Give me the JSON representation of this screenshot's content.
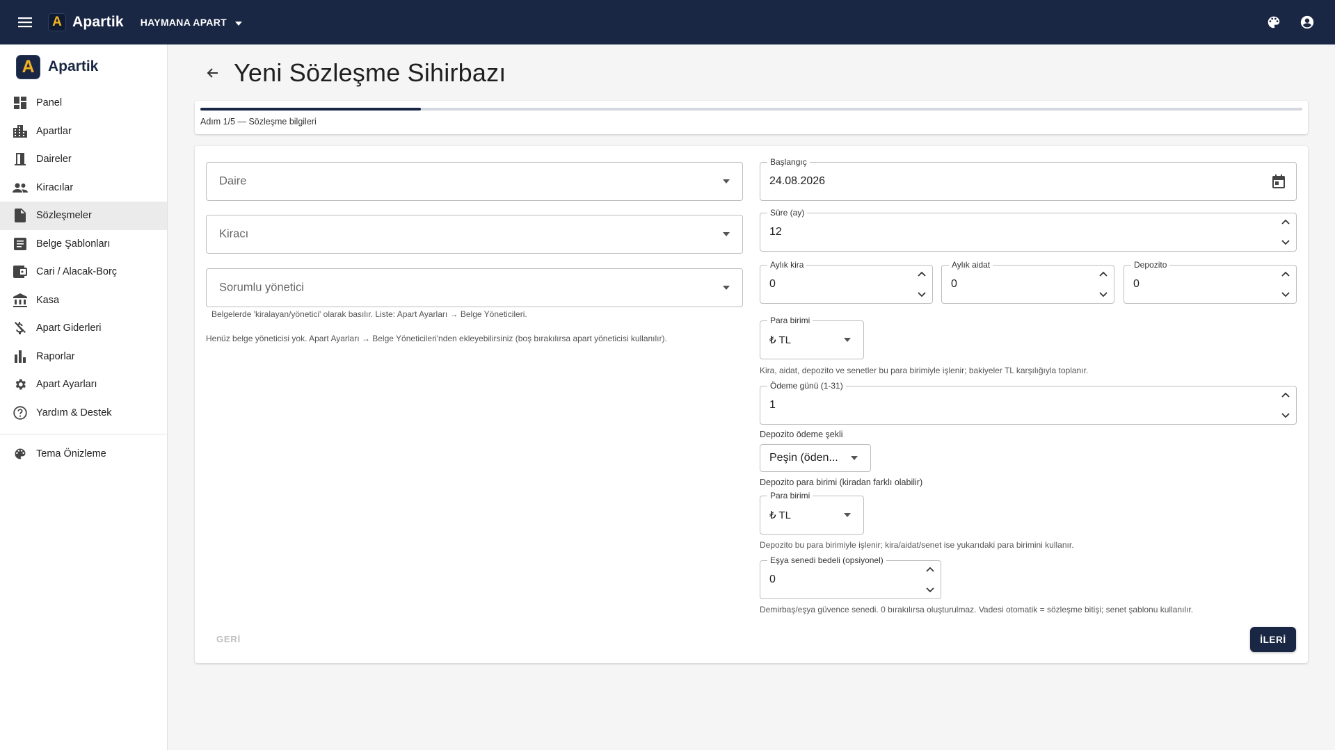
{
  "topbar": {
    "logo_letter": "A",
    "brand": "Apartik",
    "apart_name": "HAYMANA APART",
    "icons": [
      "menu-icon",
      "palette-icon",
      "account-icon"
    ]
  },
  "sidebar": {
    "logo_letter": "A",
    "brand": "Apartik",
    "items": [
      {
        "label": "Panel",
        "icon": "dashboard-icon"
      },
      {
        "label": "Apartlar",
        "icon": "apartment-icon"
      },
      {
        "label": "Daireler",
        "icon": "door-icon"
      },
      {
        "label": "Kiracılar",
        "icon": "people-icon"
      },
      {
        "label": "Sözleşmeler",
        "icon": "document-icon",
        "active": true
      },
      {
        "label": "Belge Şablonları",
        "icon": "template-icon"
      },
      {
        "label": "Cari / Alacak-Borç",
        "icon": "ledger-icon"
      },
      {
        "label": "Kasa",
        "icon": "bank-icon"
      },
      {
        "label": "Apart Giderleri",
        "icon": "money-off-icon"
      },
      {
        "label": "Raporlar",
        "icon": "bar-chart-icon"
      },
      {
        "label": "Apart Ayarları",
        "icon": "gear-icon"
      },
      {
        "label": "Yardım & Destek",
        "icon": "help-icon"
      }
    ],
    "extra_items": [
      {
        "label": "Tema Önizleme",
        "icon": "palette-icon"
      }
    ]
  },
  "page": {
    "title": "Yeni Sözleşme Sihirbazı"
  },
  "stepper": {
    "label": "Adım 1/5 — Sözleşme bilgileri",
    "progress": 0.2
  },
  "form": {
    "daire_placeholder": "Daire",
    "kiraci_placeholder": "Kiracı",
    "yonetici_placeholder": "Sorumlu yönetici",
    "yonetici_helper": "Belgelerde 'kiralayan/yönetici' olarak basılır. Liste: Apart Ayarları → Belge Yöneticileri.",
    "yonetici_info": "Henüz belge yöneticisi yok. Apart Ayarları → Belge Yöneticileri'nden ekleyebilirsiniz (boş bırakılırsa apart yöneticisi kullanılır).",
    "baslangic": {
      "label": "Başlangıç",
      "value": "24.08.2026"
    },
    "sure": {
      "label": "Süre (ay)",
      "value": "12"
    },
    "aylik_kira": {
      "label": "Aylık kira",
      "value": "0"
    },
    "aylik_aidat": {
      "label": "Aylık aidat",
      "value": "0"
    },
    "depozito": {
      "label": "Depozito",
      "value": "0"
    },
    "para_birimi": {
      "label": "Para birimi",
      "value": "₺ TL"
    },
    "para_birimi_helper": "Kira, aidat, depozito ve senetler bu para birimiyle işlenir; bakiyeler TL karşılığıyla toplanır.",
    "odeme_gunu": {
      "label": "Ödeme günü (1-31)",
      "value": "1"
    },
    "depozito_odeme_label": "Depozito ödeme şekli",
    "depozito_odeme_value": "Peşin (öden...",
    "depozito_para_label": "Depozito para birimi (kiradan farklı olabilir)",
    "depozito_para_birimi": {
      "label": "Para birimi",
      "value": "₺ TL"
    },
    "depozito_para_helper": "Depozito bu para birimiyle işlenir; kira/aidat/senet ise yukarıdaki para birimini kullanır.",
    "esya_senedi": {
      "label": "Eşya senedi bedeli (opsiyonel)",
      "value": "0"
    },
    "esya_helper": "Demirbaş/eşya güvence senedi. 0 bırakılırsa oluşturulmaz. Vadesi otomatik = sözleşme bitişi; senet şablonu kullanılır."
  },
  "actions": {
    "back_label": "GERİ",
    "next_label": "İLERİ"
  },
  "colors": {
    "primary": "#1a2744",
    "accent": "#f3b321"
  }
}
